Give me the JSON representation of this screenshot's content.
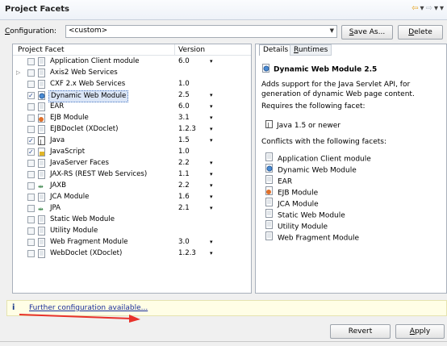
{
  "header": {
    "title": "Project Facets"
  },
  "config": {
    "label": "Configuration:",
    "value": "<custom>",
    "save_as": "Save As...",
    "delete": "Delete"
  },
  "facets": {
    "col_facet": "Project Facet",
    "col_version": "Version",
    "rows": [
      {
        "name": "Application Client module",
        "version": "6.0",
        "checked": false,
        "dropdown": true,
        "icon": "page-icon"
      },
      {
        "name": "Axis2 Web Services",
        "version": "",
        "checked": false,
        "dropdown": false,
        "icon": "page-icon"
      },
      {
        "name": "CXF 2.x Web Services",
        "version": "1.0",
        "checked": false,
        "dropdown": false,
        "icon": "page-icon"
      },
      {
        "name": "Dynamic Web Module",
        "version": "2.5",
        "checked": true,
        "dropdown": true,
        "icon": "web-module-icon"
      },
      {
        "name": "EAR",
        "version": "6.0",
        "checked": false,
        "dropdown": true,
        "icon": "page-icon"
      },
      {
        "name": "EJB Module",
        "version": "3.1",
        "checked": false,
        "dropdown": true,
        "icon": "ejb-icon"
      },
      {
        "name": "EJBDoclet (XDoclet)",
        "version": "1.2.3",
        "checked": false,
        "dropdown": true,
        "icon": "page-icon"
      },
      {
        "name": "Java",
        "version": "1.5",
        "checked": true,
        "dropdown": true,
        "icon": "java-icon"
      },
      {
        "name": "JavaScript",
        "version": "1.0",
        "checked": true,
        "dropdown": false,
        "icon": "javascript-icon"
      },
      {
        "name": "JavaServer Faces",
        "version": "2.2",
        "checked": false,
        "dropdown": true,
        "icon": "page-icon"
      },
      {
        "name": "JAX-RS (REST Web Services)",
        "version": "1.1",
        "checked": false,
        "dropdown": true,
        "icon": "page-icon"
      },
      {
        "name": "JAXB",
        "version": "2.2",
        "checked": false,
        "dropdown": true,
        "icon": "jaxb-icon"
      },
      {
        "name": "JCA Module",
        "version": "1.6",
        "checked": false,
        "dropdown": true,
        "icon": "page-icon"
      },
      {
        "name": "JPA",
        "version": "2.1",
        "checked": false,
        "dropdown": true,
        "icon": "jpa-icon"
      },
      {
        "name": "Static Web Module",
        "version": "",
        "checked": false,
        "dropdown": false,
        "icon": "page-icon"
      },
      {
        "name": "Utility Module",
        "version": "",
        "checked": false,
        "dropdown": false,
        "icon": "page-icon"
      },
      {
        "name": "Web Fragment Module",
        "version": "3.0",
        "checked": false,
        "dropdown": true,
        "icon": "page-icon"
      },
      {
        "name": "WebDoclet (XDoclet)",
        "version": "1.2.3",
        "checked": false,
        "dropdown": true,
        "icon": "page-icon"
      }
    ]
  },
  "details": {
    "tab_details": "Details",
    "tab_runtimes": "Runtimes",
    "title": "Dynamic Web Module 2.5",
    "description": "Adds support for the Java Servlet API, for generation of dynamic Web page content.",
    "requires_label": "Requires the following facet:",
    "requires_item": "Java 1.5 or newer",
    "conflicts_label": "Conflicts with the following facets:",
    "conflicts": [
      "Application Client module",
      "Dynamic Web Module",
      "EAR",
      "EJB Module",
      "JCA Module",
      "Static Web Module",
      "Utility Module",
      "Web Fragment Module"
    ]
  },
  "further": {
    "info_glyph": "i",
    "link": "Further configuration available..."
  },
  "footer": {
    "revert": "Revert",
    "apply": "Apply"
  }
}
